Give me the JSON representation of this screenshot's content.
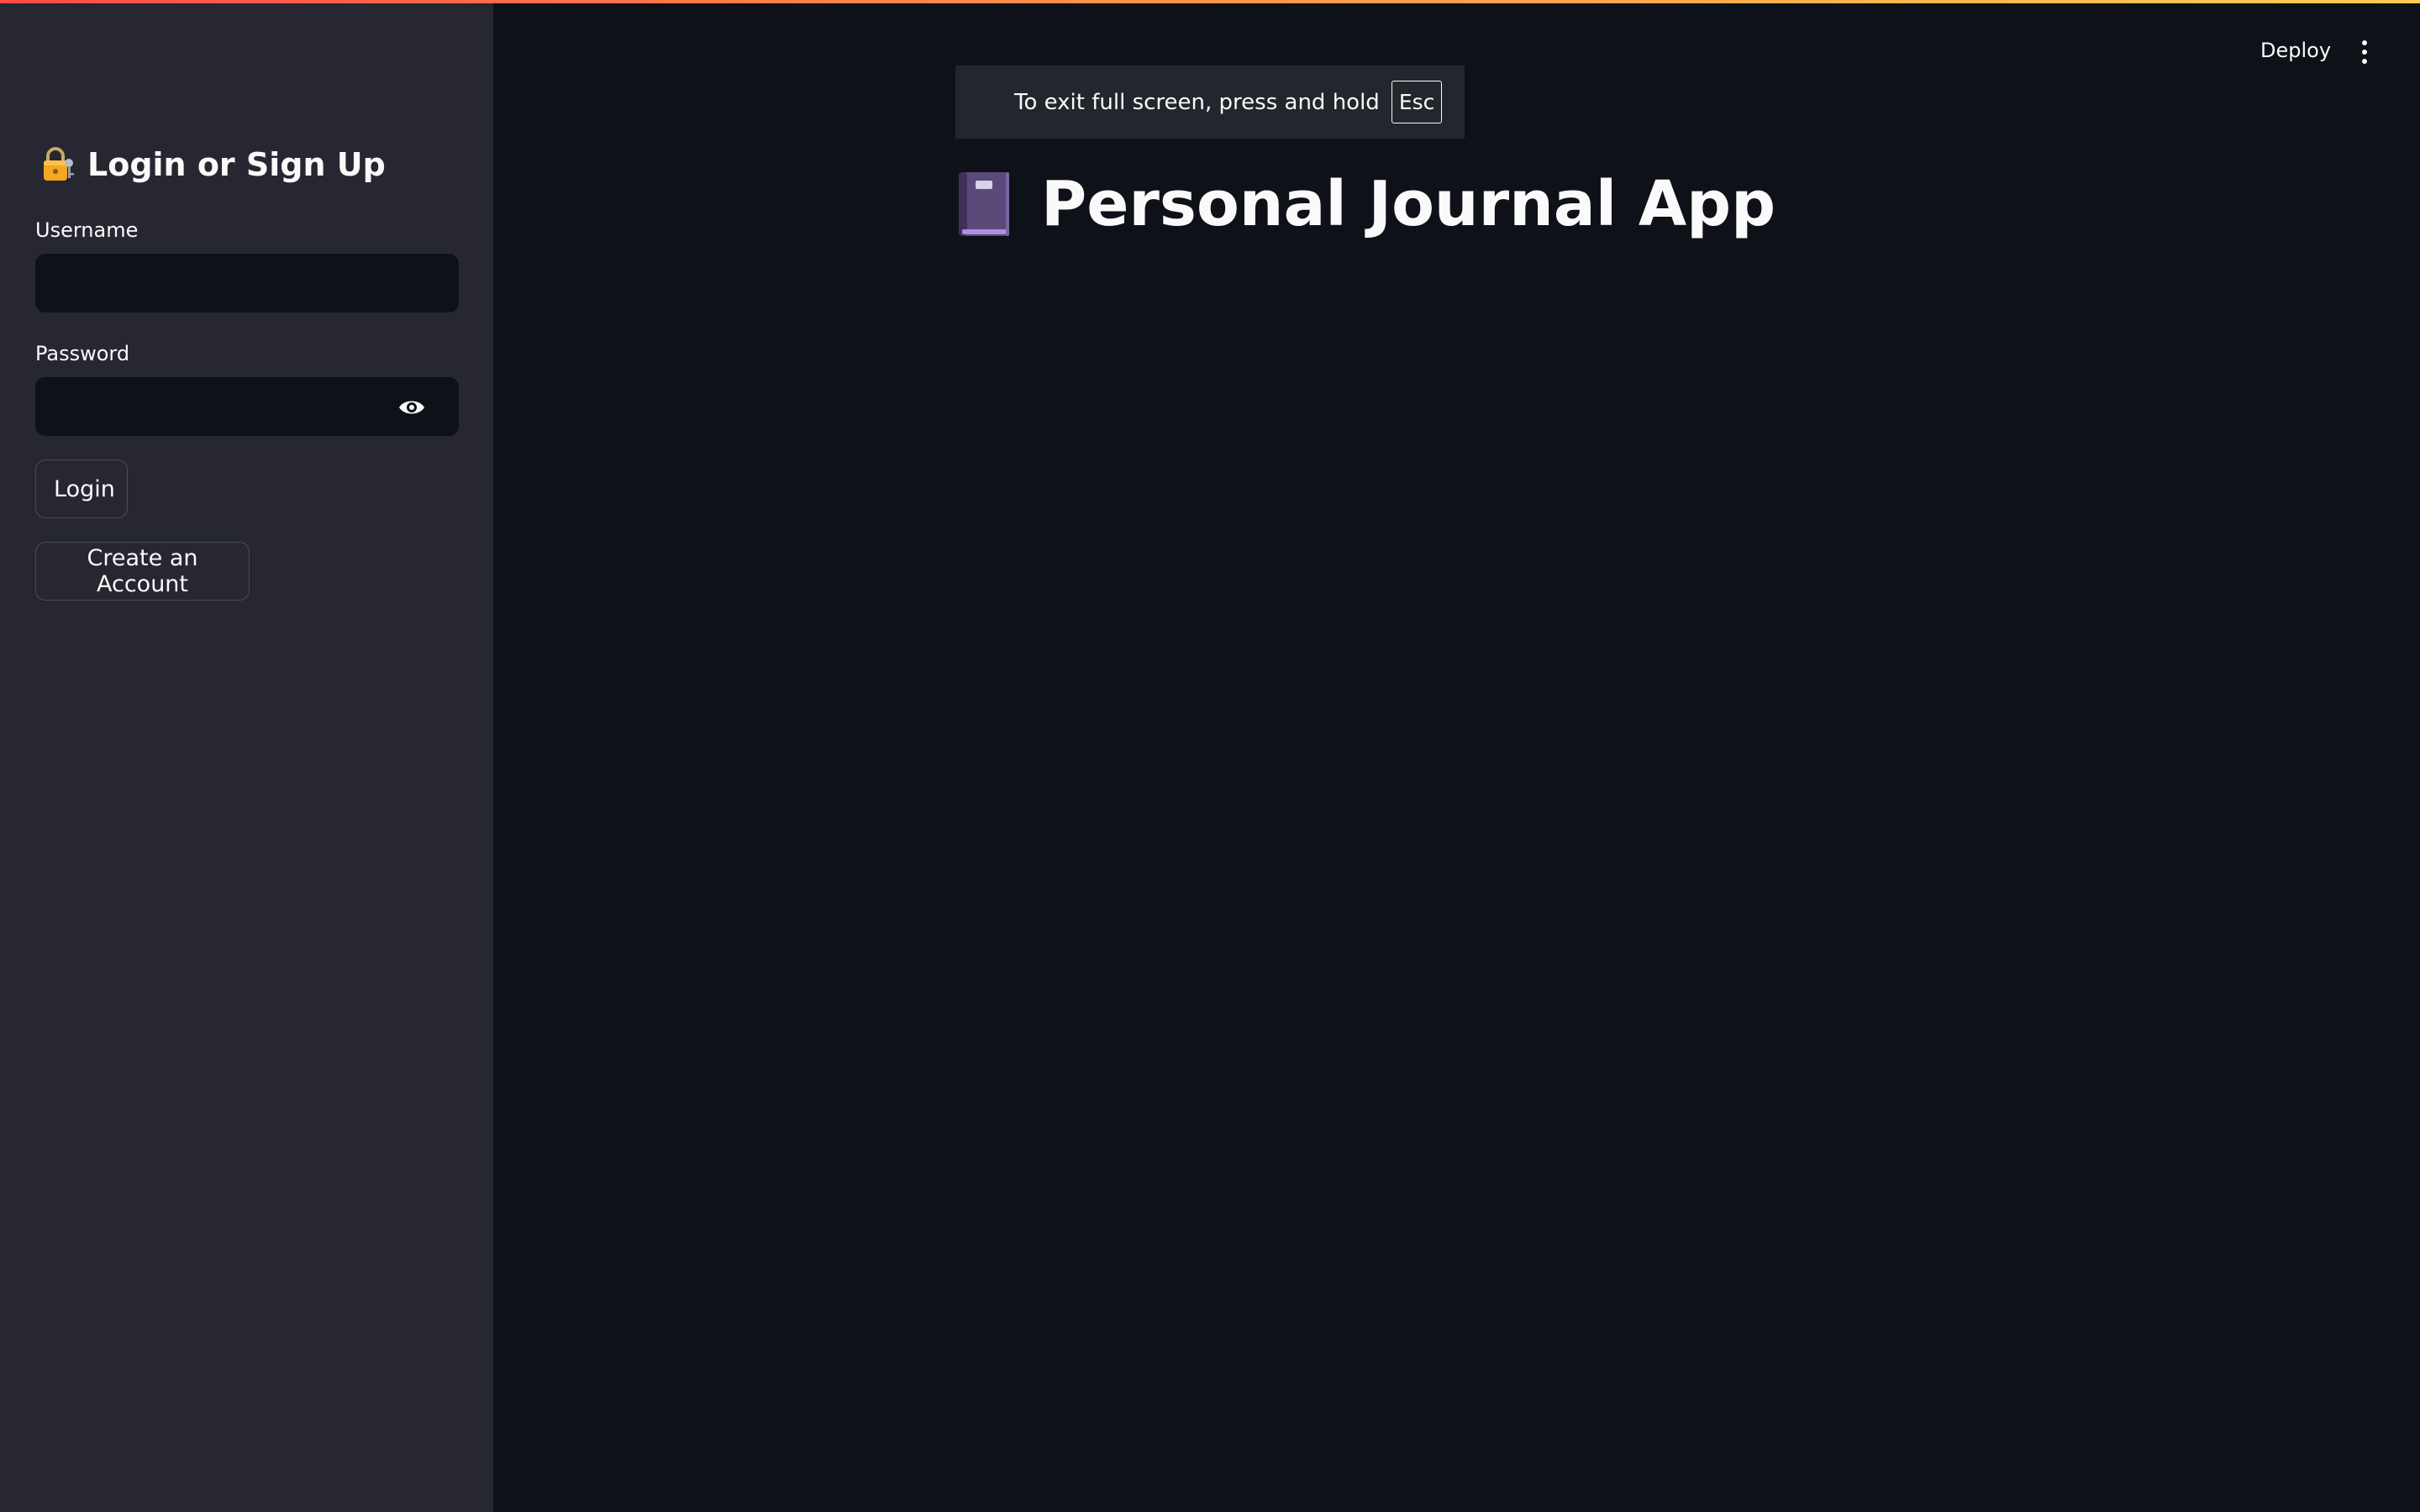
{
  "sidebar": {
    "title": "Login or Sign Up",
    "title_icon": "lock-with-key-icon",
    "username_label": "Username",
    "username_value": "",
    "password_label": "Password",
    "password_value": "",
    "login_button": "Login",
    "create_account_button": "Create an Account"
  },
  "header": {
    "deploy_label": "Deploy",
    "menu_icon": "kebab-menu-icon"
  },
  "fullscreen_notice": {
    "text": "To exit full screen, press and hold",
    "key": "Esc"
  },
  "main": {
    "title": "Personal Journal App",
    "title_icon": "purple-notebook-icon"
  },
  "colors": {
    "background": "#0e1117",
    "sidebar": "#262730",
    "text": "#fafafa",
    "accent_start": "#ff4b4b",
    "accent_end": "#ffcc55"
  }
}
